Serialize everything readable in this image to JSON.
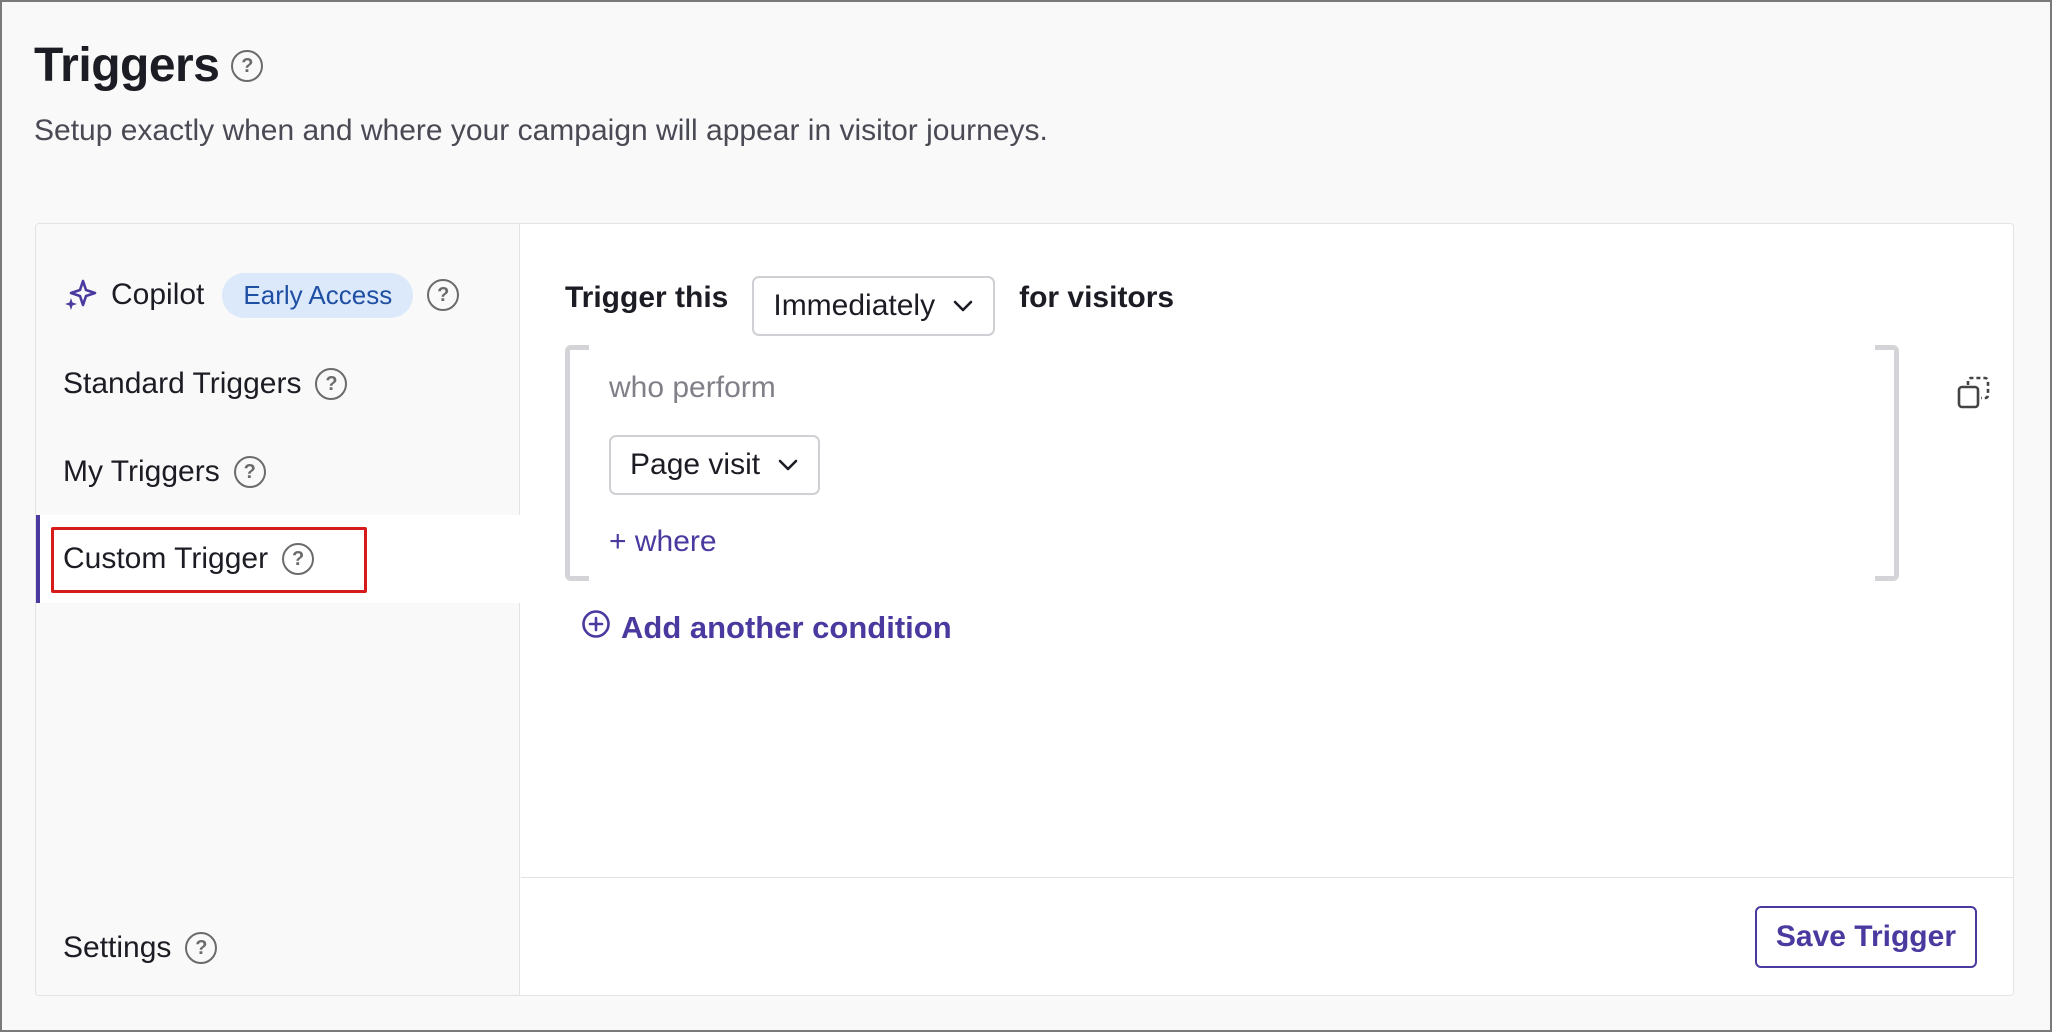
{
  "header": {
    "title": "Triggers",
    "subtitle": "Setup exactly when and where your campaign will appear in visitor journeys."
  },
  "sidebar": {
    "items": [
      {
        "label": "Copilot",
        "badge": "Early Access",
        "icon": "sparkles-icon"
      },
      {
        "label": "Standard Triggers"
      },
      {
        "label": "My Triggers"
      },
      {
        "label": "Custom Trigger",
        "active": true
      },
      {
        "label": "Settings"
      }
    ]
  },
  "main": {
    "trigger_prefix": "Trigger this",
    "timing_value": "Immediately",
    "trigger_suffix": "for visitors",
    "condition": {
      "who_label": "who perform",
      "event_value": "Page visit",
      "where_link": "+ where"
    },
    "add_condition": "Add another condition",
    "save_label": "Save Trigger"
  },
  "colors": {
    "accent": "#4a3aa0",
    "badge_bg": "#dce9fb",
    "badge_text": "#1f4fa3",
    "highlight": "#d51b1b"
  }
}
